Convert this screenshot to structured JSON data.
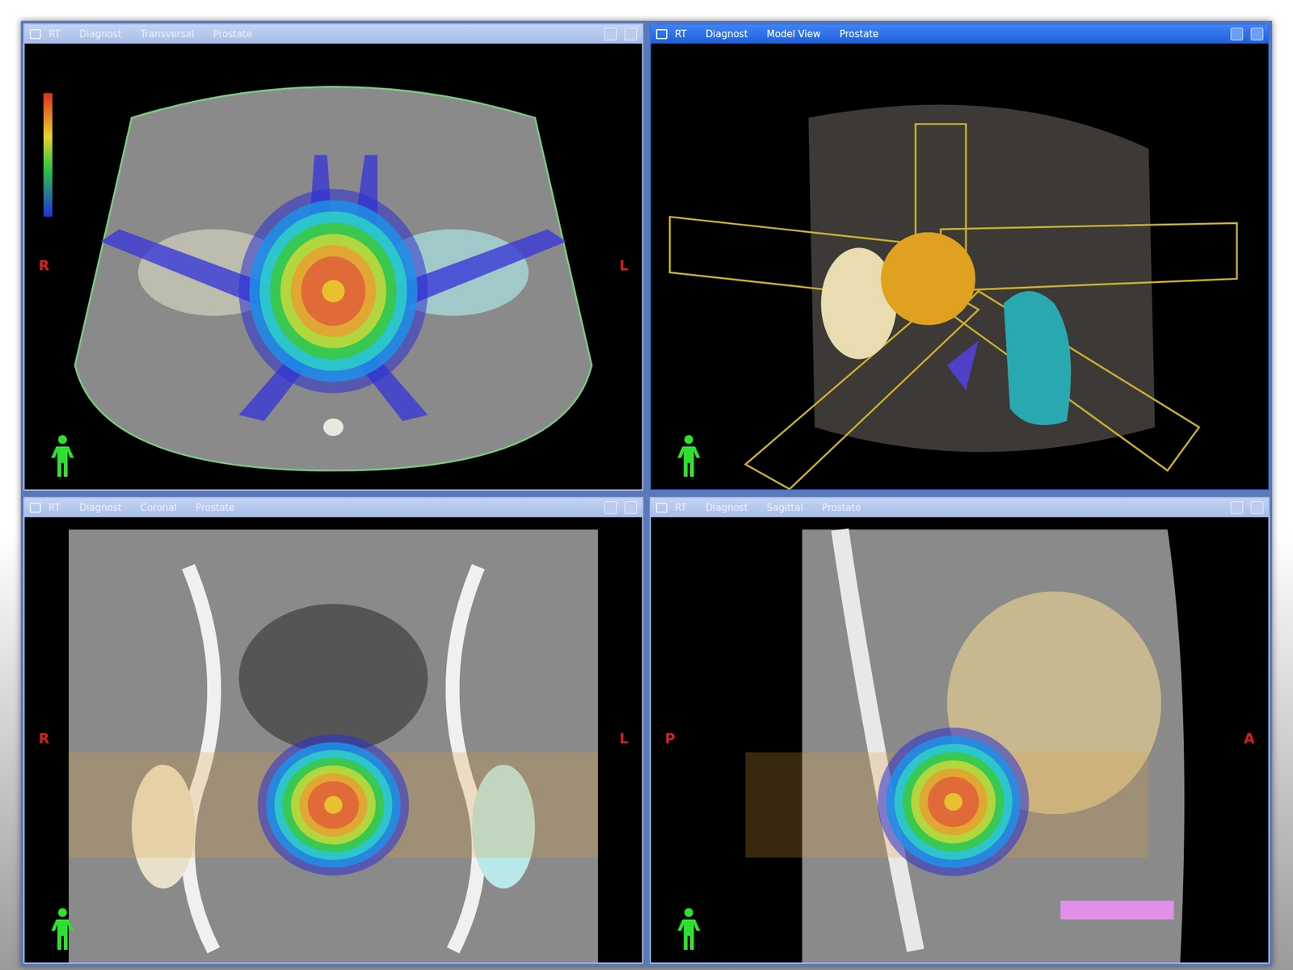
{
  "viewports": [
    {
      "kind": "axial",
      "active": false,
      "app": "RT",
      "title": [
        "Diagnost",
        "Transversal",
        "Prostate"
      ],
      "labels": [
        {
          "text": "R",
          "side": "left"
        },
        {
          "text": "L",
          "side": "right"
        }
      ]
    },
    {
      "kind": "model",
      "active": true,
      "app": "RT",
      "title": [
        "Diagnost",
        "Model View",
        "Prostate"
      ],
      "labels": []
    },
    {
      "kind": "coronal",
      "active": false,
      "app": "RT",
      "title": [
        "Diagnost",
        "Coronal",
        "Prostate"
      ],
      "labels": [
        {
          "text": "R",
          "side": "left"
        },
        {
          "text": "L",
          "side": "right"
        }
      ]
    },
    {
      "kind": "sagittal",
      "active": false,
      "app": "RT",
      "title": [
        "Diagnost",
        "Sagittal",
        "Prostate"
      ],
      "labels": [
        {
          "text": "P",
          "side": "left"
        },
        {
          "text": "A",
          "side": "right"
        }
      ]
    }
  ]
}
